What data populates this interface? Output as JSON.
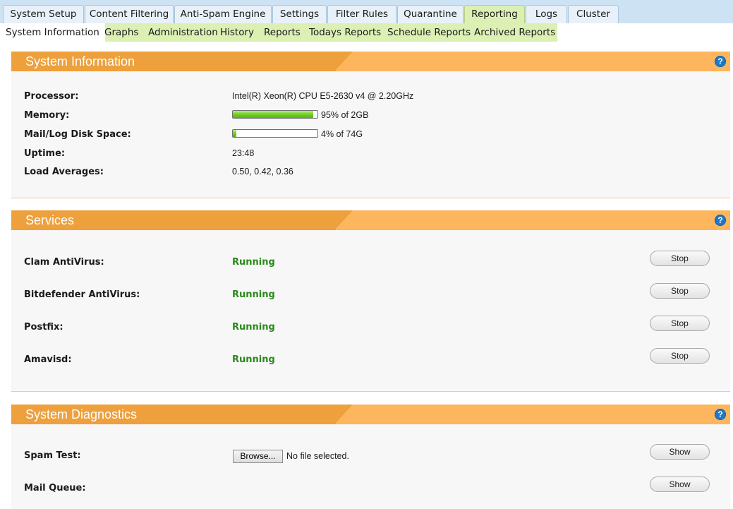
{
  "top_tabs": [
    {
      "label": "System Setup"
    },
    {
      "label": "Content Filtering"
    },
    {
      "label": "Anti-Spam Engine"
    },
    {
      "label": "Settings"
    },
    {
      "label": "Filter Rules"
    },
    {
      "label": "Quarantine"
    },
    {
      "label": "Reporting",
      "active": true
    },
    {
      "label": "Logs"
    },
    {
      "label": "Cluster"
    }
  ],
  "sub_tabs": [
    {
      "label": "System Information",
      "active": true
    },
    {
      "label": "Graphs"
    },
    {
      "label": "Administration"
    },
    {
      "label": "History"
    },
    {
      "label": "Reports"
    },
    {
      "label": "Todays Reports"
    },
    {
      "label": "Schedule Reports"
    },
    {
      "label": "Archived Reports"
    }
  ],
  "help_glyph": "?",
  "system_info": {
    "title": "System Information",
    "processor_label": "Processor:",
    "processor_value": "Intel(R) Xeon(R) CPU E5-2630 v4 @ 2.20GHz",
    "memory_label": "Memory:",
    "memory_percent": 95,
    "memory_text": "95% of 2GB",
    "disk_label": "Mail/Log Disk Space:",
    "disk_percent": 4,
    "disk_text": "4% of 74G",
    "uptime_label": "Uptime:",
    "uptime_value": "23:48",
    "load_label": "Load Averages:",
    "load_value": "0.50, 0.42, 0.36"
  },
  "services": {
    "title": "Services",
    "items": [
      {
        "name": "Clam AntiVirus:",
        "status": "Running",
        "action": "Stop"
      },
      {
        "name": "Bitdefender AntiVirus:",
        "status": "Running",
        "action": "Stop"
      },
      {
        "name": "Postfix:",
        "status": "Running",
        "action": "Stop"
      },
      {
        "name": "Amavisd:",
        "status": "Running",
        "action": "Stop"
      }
    ]
  },
  "diagnostics": {
    "title": "System Diagnostics",
    "spam_test_label": "Spam Test:",
    "browse_label": "Browse...",
    "no_file_text": "No file selected.",
    "spam_test_action": "Show",
    "mail_queue_label": "Mail Queue:",
    "mail_queue_action": "Show"
  },
  "colors": {
    "header_dark": "#eda03c",
    "header_light": "#fdb55e",
    "running": "#2a8a1a",
    "help": "#1a79cc"
  }
}
